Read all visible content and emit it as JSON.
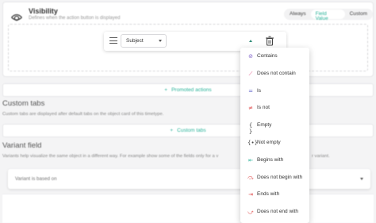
{
  "visibility": {
    "title": "Visibility",
    "subtitle": "Defines when the action button is displayed",
    "options": [
      "Always",
      "Field Value",
      "Custom"
    ],
    "active_option": "Field Value"
  },
  "condition": {
    "field_value": "Subject"
  },
  "promoted_actions": {
    "label": "Promoted actions",
    "plus": "+"
  },
  "custom_tabs": {
    "title": "Custom tabs",
    "description": "Custom tabs are displayed after default tabs on the object card of this timetype.",
    "button_label": "Custom tabs",
    "plus": "+"
  },
  "variant_field": {
    "title": "Variant field",
    "description": "Variants help visualize the same object in a different way. For example show some of the fields only for a v",
    "description_tail": "r variant.",
    "select_label": "Variant is based on"
  },
  "operators": [
    {
      "label": "Contains",
      "icon": "contains-icon",
      "glyph": "⊘",
      "color": "#7a5cc7"
    },
    {
      "label": "Does not contain",
      "icon": "does-not-contain-icon",
      "glyph": "⟋",
      "color": "#e0457b"
    },
    {
      "label": "Is",
      "icon": "equals-icon",
      "glyph": "=",
      "color": "#5b5fc7"
    },
    {
      "label": "Is not",
      "icon": "not-equals-icon",
      "glyph": "≠",
      "color": "#e04e4e"
    },
    {
      "label": "Empty",
      "icon": "empty-icon",
      "glyph": "{ }",
      "color": "#444444"
    },
    {
      "label": "Not empty",
      "icon": "not-empty-icon",
      "glyph": "{•}",
      "color": "#444444"
    },
    {
      "label": "Begins with",
      "icon": "begins-with-icon",
      "glyph": "⇤",
      "color": "#2bb39a"
    },
    {
      "label": "Does not begin with",
      "icon": "does-not-begin-with-icon",
      "glyph": "⤼",
      "color": "#e04e4e"
    },
    {
      "label": "Ends with",
      "icon": "ends-with-icon",
      "glyph": "⇥",
      "color": "#e04e4e"
    },
    {
      "label": "Does not end with",
      "icon": "does-not-end-with-icon",
      "glyph": "⤻",
      "color": "#e04e4e"
    }
  ]
}
